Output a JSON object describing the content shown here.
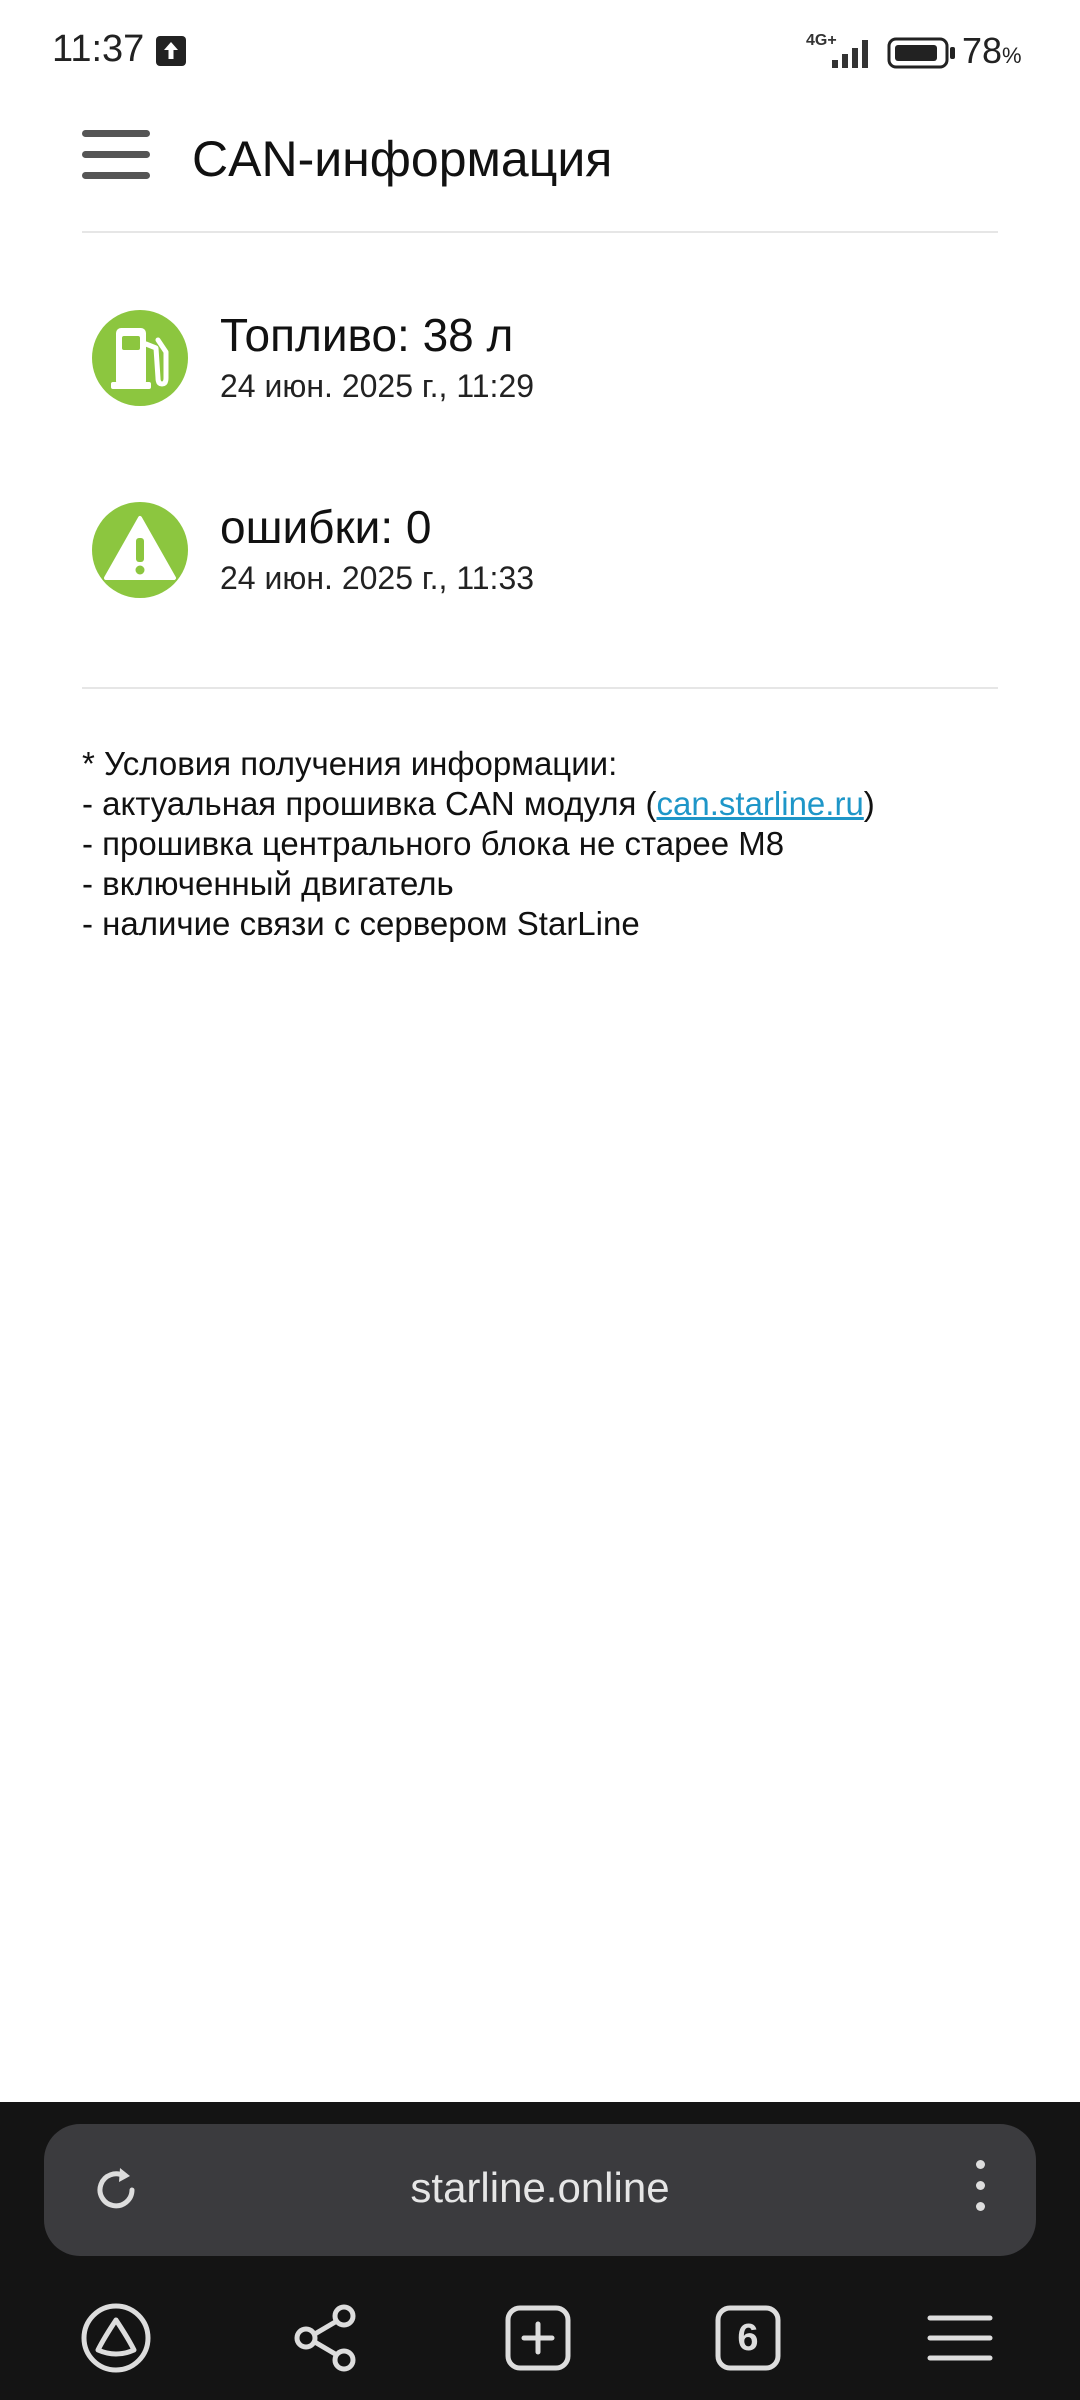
{
  "status_bar": {
    "time": "11:37",
    "network": "4G+",
    "battery_level": "78",
    "battery_unit": "%"
  },
  "header": {
    "title": "CAN-информация"
  },
  "items": [
    {
      "title": "Топливо: 38 л",
      "time": "24 июн. 2025 г., 11:29",
      "icon": "fuel-pump-icon"
    },
    {
      "title": "ошибки: 0",
      "time": "24 июн. 2025 г., 11:33",
      "icon": "warning-icon"
    }
  ],
  "notes": {
    "heading": "* Условия получения информации:",
    "line1_prefix": "- актуальная прошивка CAN модуля (",
    "line1_link": "can.starline.ru",
    "line1_suffix": ")",
    "line2": "- прошивка центрального блока не старее M8",
    "line3": "- включенный двигатель",
    "line4": "- наличие связи с сервером StarLine"
  },
  "browser": {
    "url": "starline.online",
    "tabs_count": "6"
  },
  "colors": {
    "icon_green": "#8cc63f",
    "link": "#1e96c8",
    "browser_bar": "#141414",
    "url_box": "#3b3b3e"
  }
}
